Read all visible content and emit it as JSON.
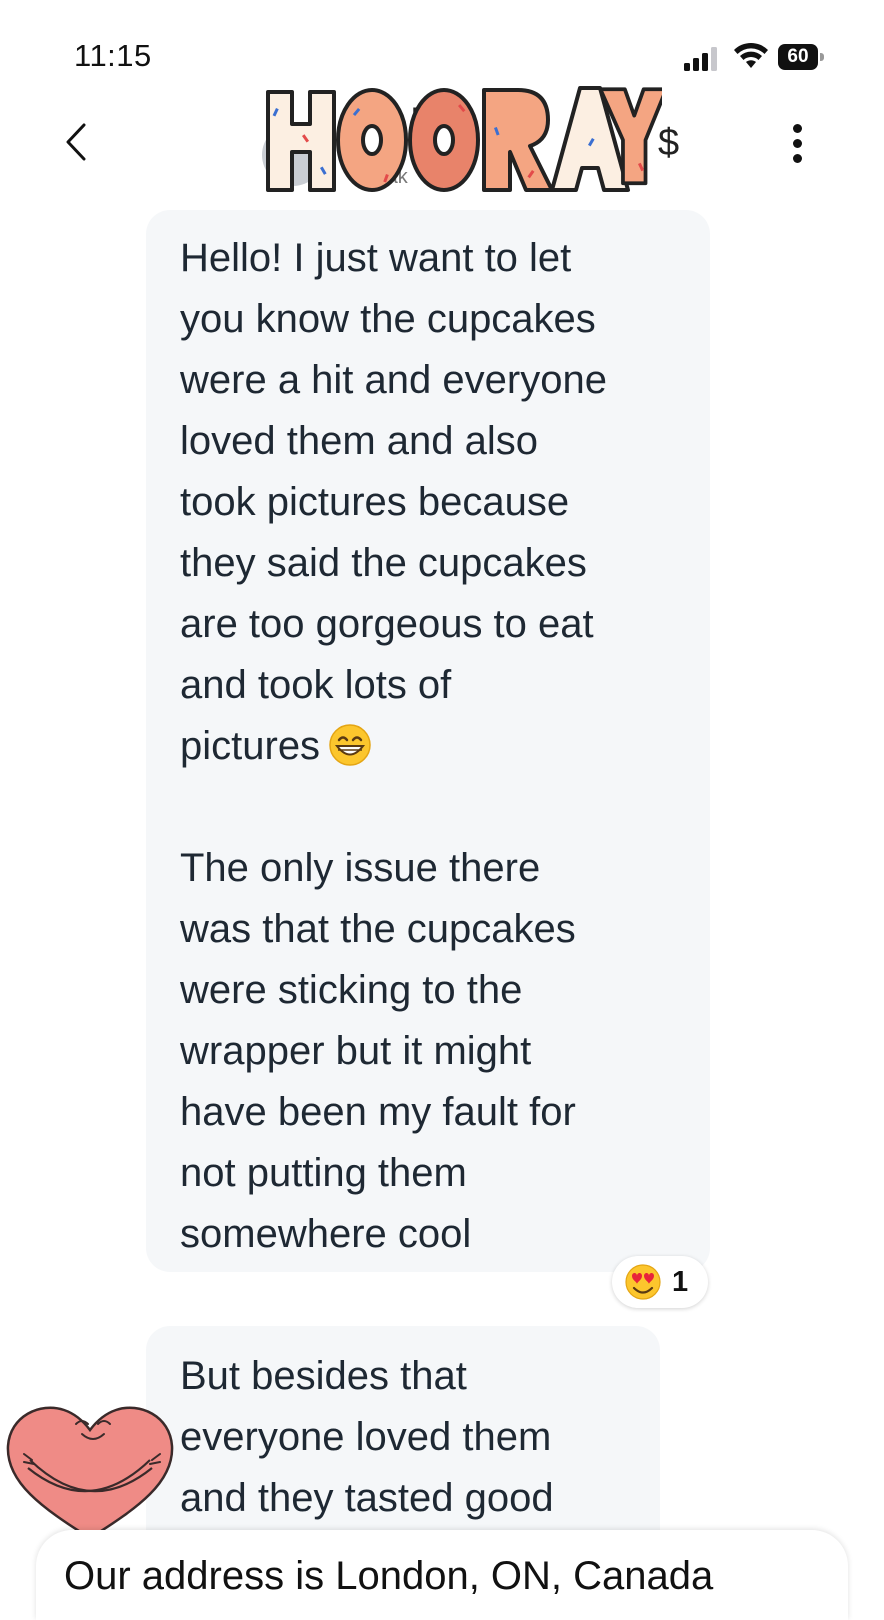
{
  "status_bar": {
    "time": "11:15",
    "battery_level": "60",
    "icons": [
      "signal-icon",
      "wifi-icon",
      "battery-icon"
    ]
  },
  "header": {
    "name_partial": "Ma",
    "sub_partial": "Mak",
    "icons": [
      "back-icon",
      "avatar",
      "dollar-icon",
      "more-icon"
    ],
    "dollar_symbol": "$"
  },
  "sticker_overlay": {
    "text": "HOORAY"
  },
  "messages": [
    {
      "paragraphs": [
        [
          "Hello! I just want to let",
          "you know the cupcakes",
          "were a hit and everyone",
          "loved them and also",
          "took pictures because",
          "they said the cupcakes",
          "are too gorgeous to eat",
          "and took lots of",
          "pictures"
        ],
        [
          "The only issue there",
          "was that the cupcakes",
          "were sticking to the",
          "wrapper but it might",
          "have been my fault for",
          "not putting them",
          "somewhere cool"
        ]
      ],
      "inline_emoji": "grinning-face-icon",
      "reaction": {
        "emoji": "heart-eyes-icon",
        "count": "1"
      }
    },
    {
      "paragraphs": [
        [
          "But besides that",
          "everyone loved them",
          "and they tasted good"
        ]
      ]
    }
  ],
  "caption": {
    "text": "Our address is London, ON, Canada"
  },
  "colors": {
    "bubble_bg": "#f5f7f9",
    "text": "#1e2833",
    "sticker_dough": "#f4a582",
    "heart_pink": "#ef8b86"
  }
}
